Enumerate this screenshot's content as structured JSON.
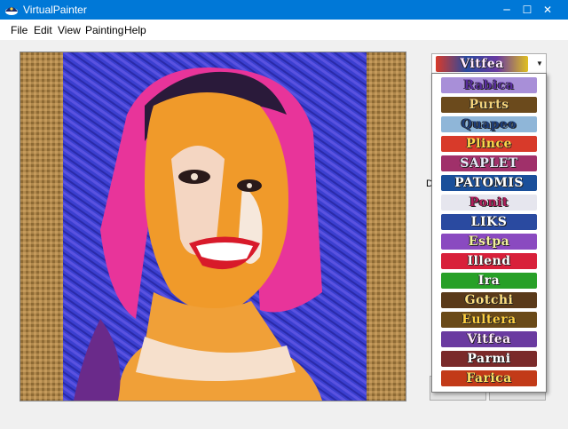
{
  "window": {
    "title": "VirtualPainter",
    "controls": {
      "minimize": "─",
      "maximize": "☐",
      "close": "✕"
    }
  },
  "menu": {
    "items": [
      "File",
      "Edit",
      "View",
      "Painting",
      "Help"
    ]
  },
  "style_selector": {
    "selected": "Vitfea",
    "arrow": "▼",
    "options": [
      {
        "label": "Rabica",
        "bg": "#a88fd8",
        "fg": "#5a2ea0"
      },
      {
        "label": "Purts",
        "bg": "#6b4a1c",
        "fg": "#f2d27a"
      },
      {
        "label": "Quapeo",
        "bg": "#8fb6d8",
        "fg": "#1f3f7a"
      },
      {
        "label": "Plince",
        "bg": "#d83a2a",
        "fg": "#ffd84a"
      },
      {
        "label": "SAPLET",
        "bg": "#a0306a",
        "fg": "#e8e8f8"
      },
      {
        "label": "PATOMIS",
        "bg": "#1a4f9a",
        "fg": "#ffffff"
      },
      {
        "label": "Ponit",
        "bg": "#e6e6ee",
        "fg": "#b01d5a"
      },
      {
        "label": "LIKS",
        "bg": "#2a4aa0",
        "fg": "#ffffff"
      },
      {
        "label": "Estpa",
        "bg": "#8a4ac0",
        "fg": "#f4f0a0"
      },
      {
        "label": "Illend",
        "bg": "#d8203a",
        "fg": "#ffffff"
      },
      {
        "label": "Ira",
        "bg": "#28a028",
        "fg": "#ffffff"
      },
      {
        "label": "Gotchi",
        "bg": "#5a3a1a",
        "fg": "#ffe080"
      },
      {
        "label": "Eultera",
        "bg": "#6a4a18",
        "fg": "#ffd040"
      },
      {
        "label": "Vitfea",
        "bg": "#6a3aa0",
        "fg": "#ffe8ff"
      },
      {
        "label": "Parmi",
        "bg": "#7a2a2a",
        "fg": "#ffffff"
      },
      {
        "label": "Farica",
        "bg": "#c23a18",
        "fg": "#ffe060"
      }
    ]
  },
  "side_label_partial": "De",
  "colors": {
    "titlebar": "#0078d7",
    "burlap": "#b0884c",
    "painting_bg": "#3b3fd0"
  }
}
